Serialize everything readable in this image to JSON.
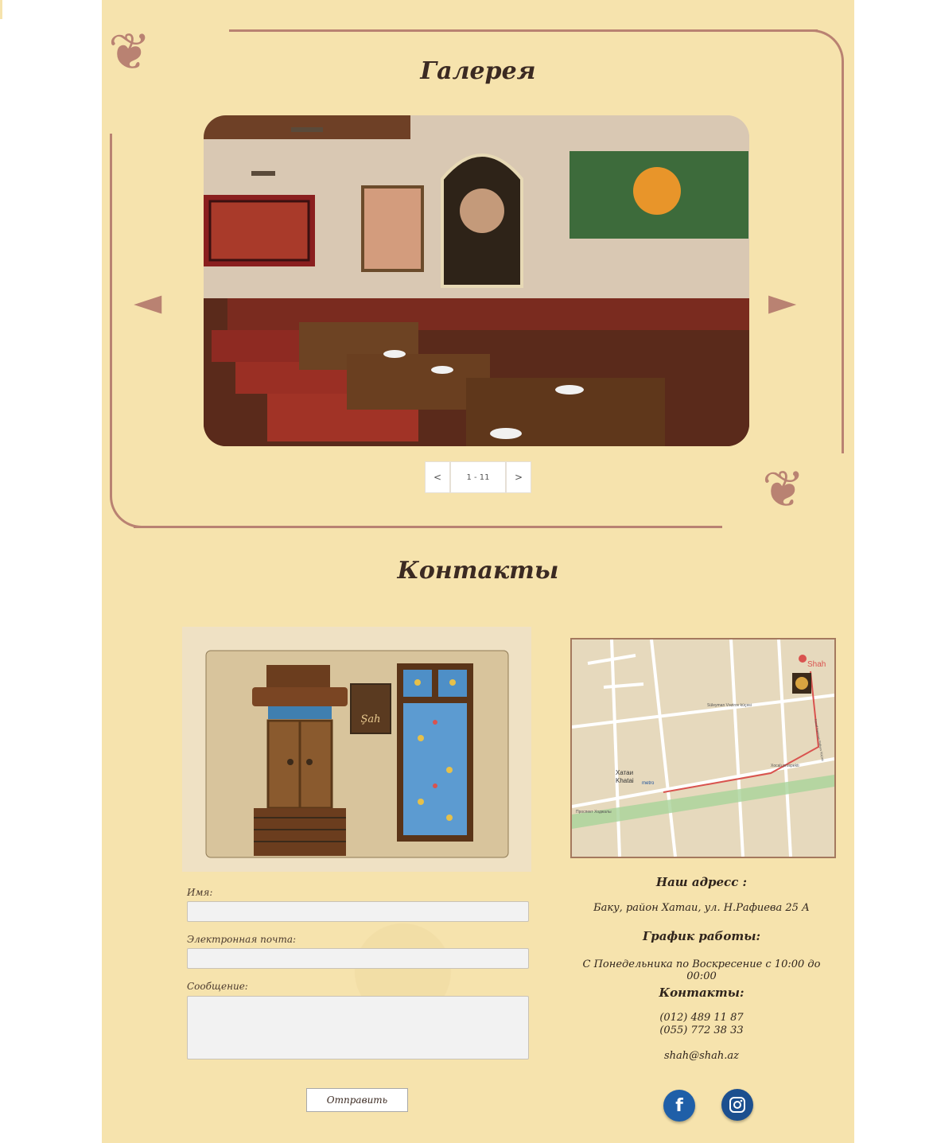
{
  "gallery": {
    "title": "Галерея",
    "prev_label": "<",
    "counter": "1 - 11",
    "next_label": ">"
  },
  "contacts": {
    "title": "Контакты",
    "form": {
      "name_label": "Имя:",
      "name_value": "",
      "email_label": "Электронная почта:",
      "email_value": "",
      "message_label": "Сообщение:",
      "message_value": "",
      "submit_label": "Отправить"
    },
    "map": {
      "pin_label": "Shah",
      "station_ru": "Хатаи",
      "station_en": "Khatai",
      "metro_label": "metro",
      "street_1": "Süleyman Vəzirov küçəsi",
      "street_2": "Xocalı prospekti",
      "street_3": "Проспект Ходжалы",
      "street_4": "Nəcəf Nəriman Rafiyev küçəsi"
    },
    "sign_label": "Şah",
    "address_heading": "Наш адресс :",
    "address_text": "Баку, район Хатаи, ул. Н.Рафиева 25 А",
    "hours_heading": "График работы:",
    "hours_text": "С Понедельника по Воскресение с 10:00 до 00:00",
    "contacts_heading": "Контакты:",
    "phone_1": "(012) 489 11 87",
    "phone_2": "(055) 772 38 33",
    "email": "shah@shah.az",
    "social": {
      "facebook_icon": "facebook-icon",
      "instagram_icon": "instagram-icon",
      "facebook_letter": "f",
      "facebook_color": "#1f5fa8",
      "instagram_color": "#1c4f8f"
    }
  }
}
